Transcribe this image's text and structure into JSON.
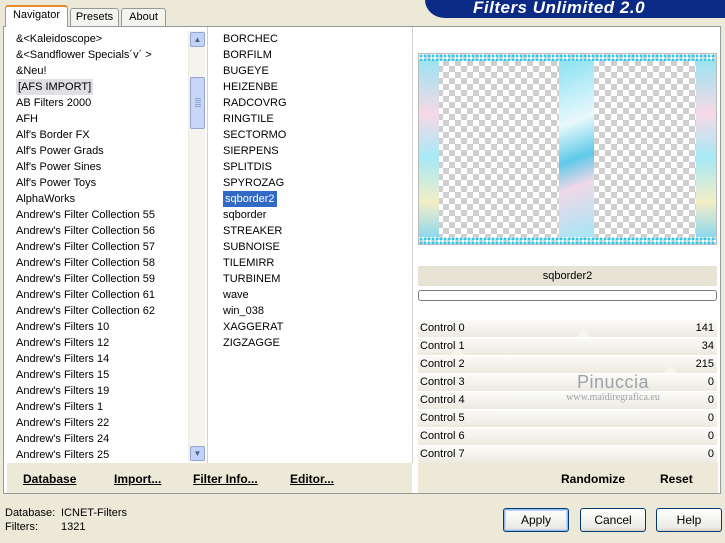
{
  "banner": {
    "title": "Filters Unlimited 2.0"
  },
  "tabs": [
    {
      "label": "Navigator",
      "active": true
    },
    {
      "label": "Presets",
      "active": false
    },
    {
      "label": "About",
      "active": false
    }
  ],
  "categories": {
    "items": [
      "&<Kaleidoscope>",
      "&<Sandflower Specials´v´ >",
      "&Neu!",
      "[AFS IMPORT]",
      "AB Filters 2000",
      "AFH",
      "Alf's Border FX",
      "Alf's Power Grads",
      "Alf's Power Sines",
      "Alf's Power Toys",
      "AlphaWorks",
      "Andrew's Filter Collection 55",
      "Andrew's Filter Collection 56",
      "Andrew's Filter Collection 57",
      "Andrew's Filter Collection 58",
      "Andrew's Filter Collection 59",
      "Andrew's Filter Collection 61",
      "Andrew's Filter Collection 62",
      "Andrew's Filters 10",
      "Andrew's Filters 12",
      "Andrew's Filters 14",
      "Andrew's Filters 15",
      "Andrew's Filters 19",
      "Andrew's Filters 1",
      "Andrew's Filters 22",
      "Andrew's Filters 24",
      "Andrew's Filters 25"
    ],
    "selected": "[AFS IMPORT]"
  },
  "filters": {
    "items": [
      "BORCHEC",
      "BORFILM",
      "BUGEYE",
      "HEIZENBE",
      "RADCOVRG",
      "RINGTILE",
      "SECTORMO",
      "SIERPENS",
      "SPLITDIS",
      "SPYROZAG",
      "sqborder2",
      "sqborder",
      "STREAKER",
      "SUBNOISE",
      "TILEMIRR",
      "TURBINEM",
      "wave",
      "win_038",
      "XAGGERAT",
      "ZIGZAGGE"
    ],
    "selected": "sqborder2"
  },
  "nav_links": {
    "database": "Database",
    "import": "Import...",
    "filter_info": "Filter Info...",
    "editor": "Editor..."
  },
  "preview": {
    "filter_name": "sqborder2",
    "progress": 0
  },
  "controls": [
    {
      "label": "Control 0",
      "value": "141",
      "level": 0.553
    },
    {
      "label": "Control 1",
      "value": "34",
      "level": 0.133
    },
    {
      "label": "Control 2",
      "value": "215",
      "level": 0.843
    },
    {
      "label": "Control 3",
      "value": "0",
      "level": 0
    },
    {
      "label": "Control 4",
      "value": "0",
      "level": 0
    },
    {
      "label": "Control 5",
      "value": "0",
      "level": 0
    },
    {
      "label": "Control 6",
      "value": "0",
      "level": 0
    },
    {
      "label": "Control 7",
      "value": "0",
      "level": 0
    }
  ],
  "control_actions": {
    "randomize": "Randomize",
    "reset": "Reset"
  },
  "watermark": {
    "name": "Pinuccia",
    "url": "www.maidiregrafica.eu"
  },
  "footer": {
    "database_label": "Database:",
    "database_value": "ICNET-Filters",
    "filters_label": "Filters:",
    "filters_value": "1321"
  },
  "buttons": {
    "apply": "Apply",
    "cancel": "Cancel",
    "help": "Help"
  },
  "colors": {
    "banner_bg": "#0A2A86",
    "window_bg": "#ECE9D8",
    "selection_blue": "#316AC5",
    "tab_accent": "#E68B2C"
  }
}
